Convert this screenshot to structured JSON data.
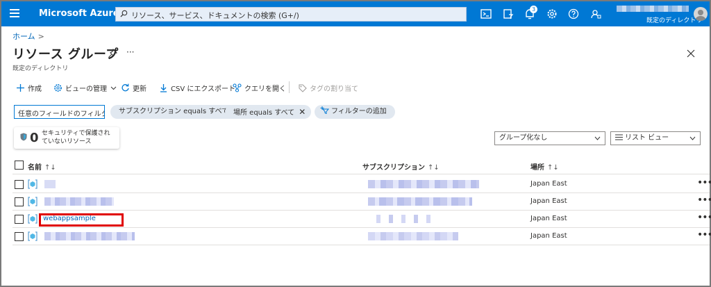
{
  "topbar": {
    "brand": "Microsoft Azure",
    "search_placeholder": "リソース、サービス、ドキュメントの検索 (G+/)",
    "notification_count": "3",
    "directory": "既定のディレクトリ",
    "bg_color": "#0078d4"
  },
  "breadcrumb": {
    "home": "ホーム",
    "separator": ">"
  },
  "page": {
    "title": "リソース グループ",
    "more": "···",
    "subtitle": "既定のディレクトリ"
  },
  "commands": {
    "create": "作成",
    "manage_view": "ビューの管理",
    "refresh": "更新",
    "export_csv": "CSV にエクスポート",
    "open_query": "クエリを開く",
    "assign_tags": "タグの割り当て"
  },
  "filters": {
    "input_placeholder": "任意のフィールドのフィルター...",
    "subscription_pill": "サブスクリプション equals すべて",
    "location_pill": "場所 equals すべて",
    "add_filter": "フィルターの追加"
  },
  "security": {
    "count": "0",
    "text": "セキュリティで保護されていないリソース"
  },
  "grouping": {
    "selected": "グループ化なし"
  },
  "view_mode": {
    "selected": "リスト ビュー"
  },
  "table": {
    "columns": {
      "name": "名前",
      "subscription": "サブスクリプション",
      "location": "場所",
      "sort": "↑↓"
    },
    "rows": [
      {
        "name": "",
        "location": "Japan East",
        "more": "•••"
      },
      {
        "name": "",
        "location": "Japan East",
        "more": "•••"
      },
      {
        "name": "webappsample",
        "location": "Japan East",
        "more": "•••"
      },
      {
        "name": "",
        "location": "Japan East",
        "more": "•••"
      }
    ]
  },
  "icons": {
    "menu": "hamburger-icon",
    "search": "search-icon",
    "cloud_shell": "cloud-shell-icon",
    "directory_filter": "directory-filter-icon",
    "notifications": "bell-icon",
    "settings": "gear-icon",
    "help": "help-icon",
    "feedback": "feedback-icon"
  },
  "colors": {
    "accent": "#0078d4",
    "link": "#0066b8",
    "highlight": "#e00000"
  }
}
